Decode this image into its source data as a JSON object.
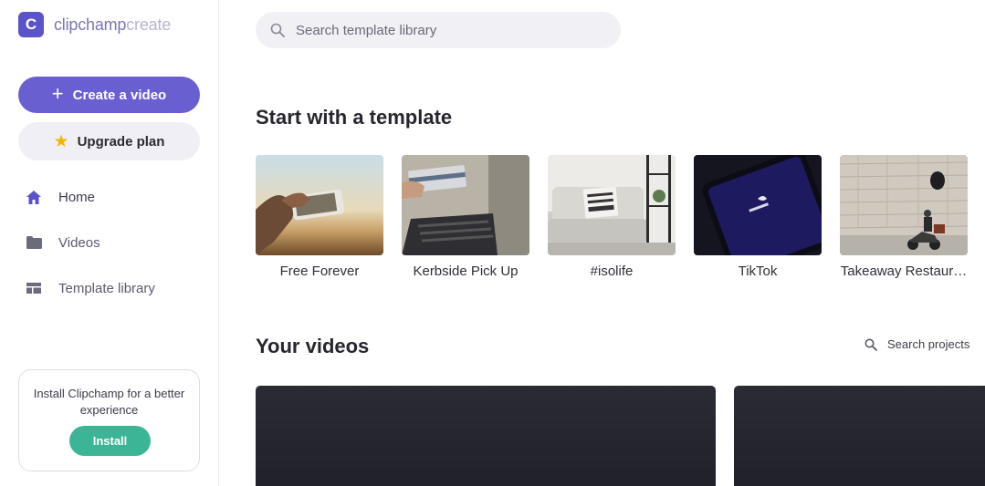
{
  "brand": {
    "mark": "C",
    "name_bold": "clipchamp",
    "name_light": "create",
    "accent": "#6a5fd1"
  },
  "sidebar": {
    "create_label": "Create a video",
    "upgrade_label": "Upgrade plan",
    "nav": [
      {
        "label": "Home",
        "icon": "home-icon"
      },
      {
        "label": "Videos",
        "icon": "folder-icon"
      },
      {
        "label": "Template library",
        "icon": "template-icon"
      }
    ],
    "install": {
      "text": "Install Clipchamp for a better experience",
      "button": "Install",
      "color": "#3cb596"
    }
  },
  "search": {
    "placeholder": "Search template library"
  },
  "templates_section": {
    "title": "Start with a template",
    "items": [
      {
        "label": "Free Forever"
      },
      {
        "label": "Kerbside Pick Up"
      },
      {
        "label": "#isolife"
      },
      {
        "label": "TikTok"
      },
      {
        "label": "Takeaway Restaur…"
      }
    ]
  },
  "videos_section": {
    "title": "Your videos",
    "search_label": "Search projects"
  }
}
